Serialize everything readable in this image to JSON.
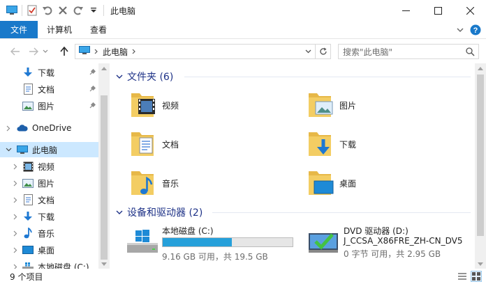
{
  "window": {
    "title": "此电脑"
  },
  "ribbon": {
    "tabs": [
      {
        "label": "文件"
      },
      {
        "label": "计算机"
      },
      {
        "label": "查看"
      }
    ]
  },
  "address": {
    "crumb": "此电脑",
    "search_placeholder": "搜索\"此电脑\""
  },
  "nav": {
    "items": [
      {
        "label": "下载",
        "icon": "download-arrow-icon",
        "pinned": true
      },
      {
        "label": "文档",
        "icon": "document-icon",
        "pinned": true
      },
      {
        "label": "图片",
        "icon": "pictures-icon",
        "pinned": true
      },
      {
        "label": "OneDrive",
        "icon": "cloud-icon"
      },
      {
        "label": "此电脑",
        "icon": "computer-icon",
        "selected": true
      },
      {
        "label": "视频",
        "icon": "video-icon"
      },
      {
        "label": "图片",
        "icon": "pictures-icon"
      },
      {
        "label": "文档",
        "icon": "document-icon"
      },
      {
        "label": "下载",
        "icon": "download-arrow-icon"
      },
      {
        "label": "音乐",
        "icon": "music-note-icon"
      },
      {
        "label": "桌面",
        "icon": "desktop-icon"
      },
      {
        "label": "本地磁盘 (C:)",
        "icon": "drive-icon"
      }
    ]
  },
  "folders": {
    "header": "文件夹 (6)",
    "items": [
      {
        "label": "视频",
        "icon": "video-folder-icon"
      },
      {
        "label": "图片",
        "icon": "pictures-folder-icon"
      },
      {
        "label": "文档",
        "icon": "documents-folder-icon"
      },
      {
        "label": "下载",
        "icon": "downloads-folder-icon"
      },
      {
        "label": "音乐",
        "icon": "music-folder-icon"
      },
      {
        "label": "桌面",
        "icon": "desktop-folder-icon"
      }
    ]
  },
  "devices": {
    "header": "设备和驱动器 (2)",
    "local_disk": {
      "name": "本地磁盘 (C:)",
      "free_text": "9.16 GB 可用，共 19.5 GB",
      "used_fraction": 0.53
    },
    "dvd": {
      "name": "DVD 驱动器 (D:)",
      "label": "J_CCSA_X86FRE_ZH-CN_DV5",
      "free_text": "0 字节 可用，共 2.95 GB"
    }
  },
  "status": {
    "count": "9 个项目"
  },
  "colors": {
    "accent": "#1979ca",
    "selection": "#cce8ff",
    "group_header": "#1e3287",
    "bar_fill": "#26a0da",
    "folder": "#f3cd63"
  }
}
